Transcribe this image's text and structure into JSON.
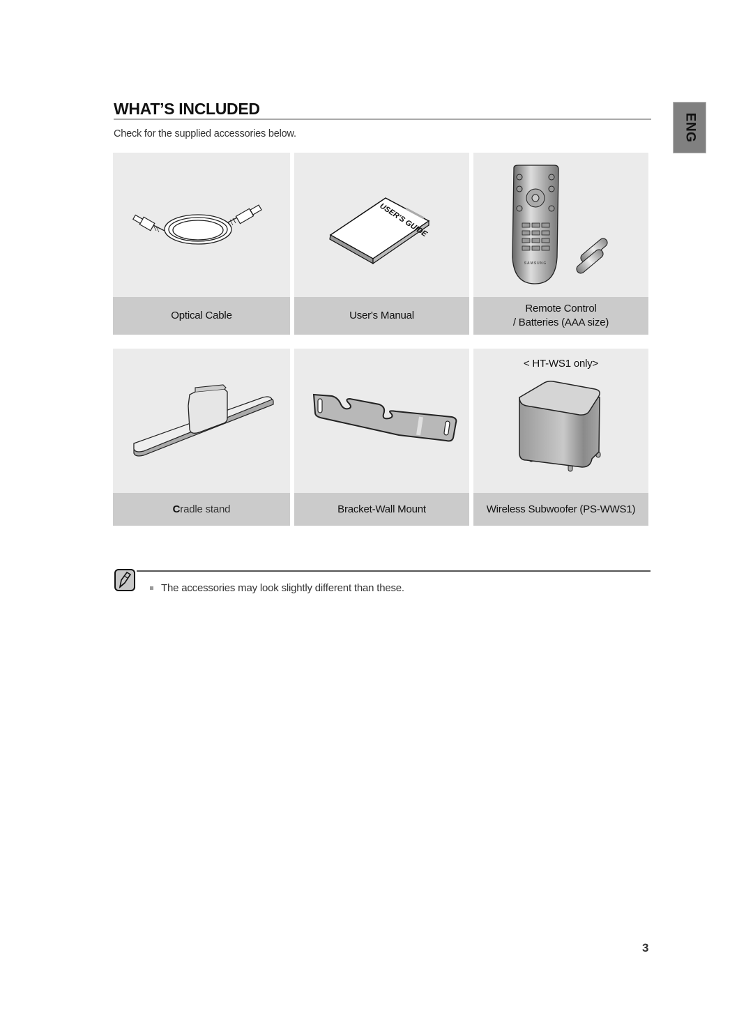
{
  "page": {
    "title": "WHAT’S INCLUDED",
    "intro": "Check for the supplied accessories below.",
    "language_tab": "ENG",
    "page_number": "3"
  },
  "accessories": [
    {
      "label": "Optical Cable",
      "icon": "optical-cable-icon"
    },
    {
      "label": "User's Manual",
      "icon": "users-manual-icon",
      "cover_text": "USER'S GUIDE"
    },
    {
      "label_line1": "Remote Control",
      "label_line2": "/ Batteries (AAA size)",
      "icon": "remote-control-icon",
      "brand_text": "SAMSUNG"
    },
    {
      "label_first": "C",
      "label_rest": "radle stand",
      "icon": "cradle-stand-icon"
    },
    {
      "label": "Bracket-Wall Mount",
      "icon": "wall-bracket-icon"
    },
    {
      "label": "Wireless Subwoofer (PS-WWS1)",
      "icon": "subwoofer-icon",
      "model_note": "< HT-WS1 only>"
    }
  ],
  "note": {
    "icon": "note-pencil-icon",
    "items": [
      "The accessories may look slightly different than these."
    ]
  }
}
